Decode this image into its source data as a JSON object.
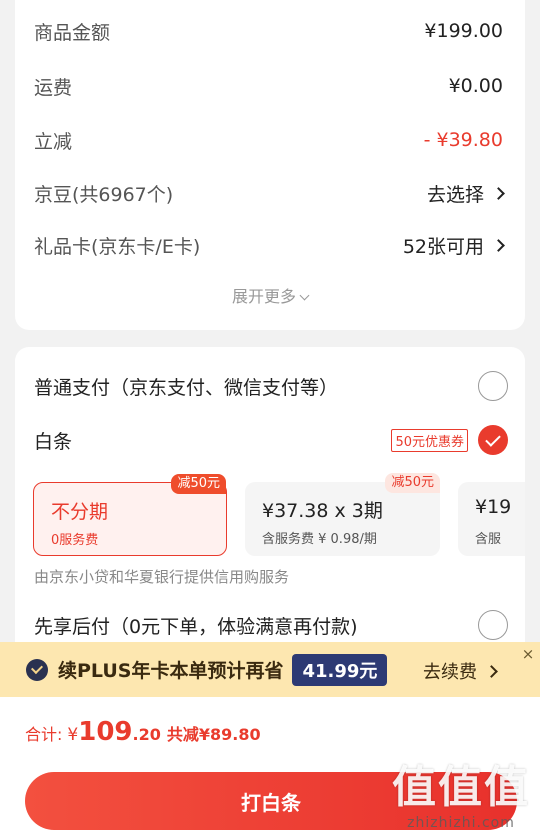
{
  "price_details": {
    "rows": [
      {
        "label": "商品金额",
        "value": "¥199.00"
      },
      {
        "label": "运费",
        "value": "¥0.00"
      },
      {
        "label": "立减",
        "value": "- ¥39.80"
      },
      {
        "label": "京豆(共6967个)",
        "value": "去选择"
      },
      {
        "label": "礼品卡(京东卡/E卡)",
        "value": "52张可用"
      }
    ],
    "expand_label": "展开更多"
  },
  "payment": {
    "normal_label": "普通支付（京东支付、微信支付等）",
    "baitiao_label": "白条",
    "baitiao_coupon": "50元优惠券",
    "plans": [
      {
        "title": "不分期",
        "subtitle": "0服务费",
        "tag": "减50元",
        "selected": true
      },
      {
        "title": "¥37.38 x 3期",
        "subtitle": "含服务费 ¥ 0.98/期",
        "tag": "减50元",
        "selected": false
      },
      {
        "title": "¥19",
        "subtitle": "含服",
        "tag": "",
        "selected": false
      }
    ],
    "provider_note": "由京东小贷和华夏银行提供信用购服务",
    "later_label": "先享后付（0元下单，体验满意再付款)"
  },
  "plus_banner": {
    "text": "续PLUS年卡本单预计再省",
    "price": "41.99元",
    "action": "去续费",
    "close": "×"
  },
  "footer": {
    "total_label": "合计:",
    "currency": "¥",
    "amount_int": "109",
    "amount_dec": ".20",
    "saved": "共减¥89.80",
    "button_label": "打白条"
  },
  "watermark": {
    "big": "值值值",
    "small": "zhizhizhi.com"
  },
  "colors": {
    "accent": "#e93b2d",
    "plus_banner_bg": "#fde7b0",
    "plus_price_bg": "#2d3a74"
  }
}
